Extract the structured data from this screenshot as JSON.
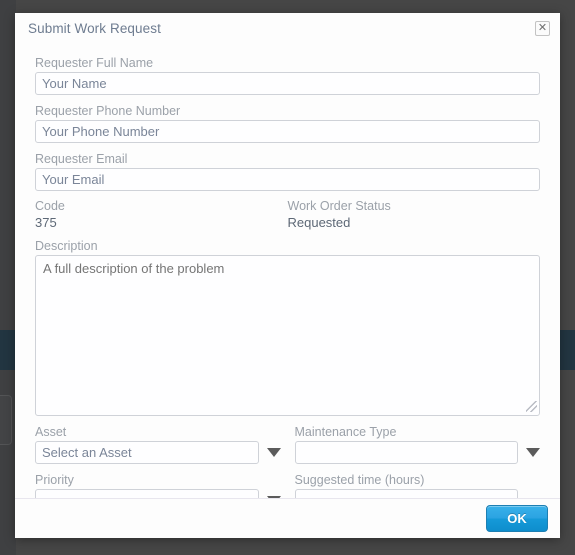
{
  "modal": {
    "title": "Submit Work Request",
    "close_label": "✕"
  },
  "form": {
    "requester_name": {
      "label": "Requester Full Name",
      "placeholder": "Your Name",
      "value": ""
    },
    "requester_phone": {
      "label": "Requester Phone Number",
      "placeholder": "Your Phone Number",
      "value": ""
    },
    "requester_email": {
      "label": "Requester Email",
      "placeholder": "Your Email",
      "value": ""
    },
    "code": {
      "label": "Code",
      "value": "375"
    },
    "work_order_status": {
      "label": "Work Order Status",
      "value": "Requested"
    },
    "description": {
      "label": "Description",
      "placeholder": "A full description of the problem",
      "value": ""
    },
    "asset": {
      "label": "Asset",
      "placeholder": "Select an Asset",
      "value": ""
    },
    "maintenance_type": {
      "label": "Maintenance Type",
      "placeholder": "",
      "value": ""
    },
    "priority": {
      "label": "Priority",
      "placeholder": "",
      "value": ""
    },
    "suggested_time": {
      "label": "Suggested time (hours)",
      "placeholder": "",
      "value": ""
    }
  },
  "footer": {
    "ok_label": "OK"
  },
  "colors": {
    "accent": "#2ba3e2",
    "backdrop": "#464646",
    "sidebar_navy": "#223541",
    "label_gray": "#9ba1a9",
    "placeholder": "#7a8598",
    "title": "#6e7c90"
  }
}
